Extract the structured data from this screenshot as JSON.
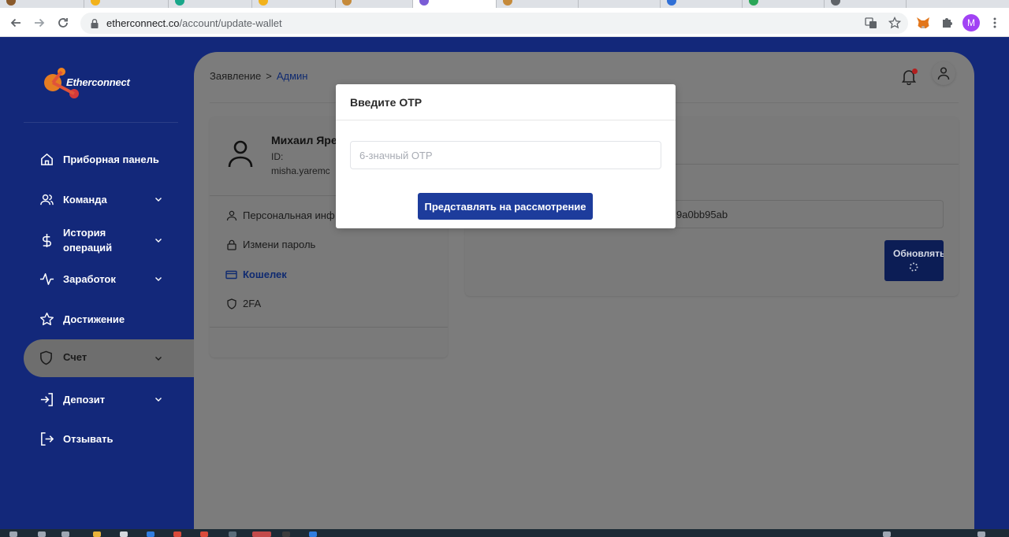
{
  "browser": {
    "url_domain": "etherconnect.co",
    "url_path": "/account/update-wallet",
    "profile_initial": "M"
  },
  "colors": {
    "sidebar_bg": "#13287a",
    "primary_button": "#1d3c9c",
    "accent_text": "#0f2a70",
    "notification_dot": "#b21f1f",
    "logo_orange": "#f0821e",
    "logo_red": "#d43a3a"
  },
  "logo": {
    "text": "Etherconnect"
  },
  "sidebar": {
    "items": [
      {
        "label": "Приборная панель",
        "icon": "home-icon",
        "has_chevron": false
      },
      {
        "label": "Команда",
        "icon": "users-icon",
        "has_chevron": true
      },
      {
        "label": "История операций",
        "icon": "dollar-icon",
        "has_chevron": true
      },
      {
        "label": "Заработок",
        "icon": "activity-icon",
        "has_chevron": true
      },
      {
        "label": "Достижение",
        "icon": "star-icon",
        "has_chevron": false
      },
      {
        "label": "Счет",
        "icon": "shield-icon",
        "has_chevron": true,
        "active": true
      },
      {
        "label": "Депозит",
        "icon": "login-icon",
        "has_chevron": true
      },
      {
        "label": "Отзывать",
        "icon": "logout-icon",
        "has_chevron": false
      }
    ]
  },
  "header": {
    "breadcrumb_parent": "Заявление",
    "breadcrumb_separator": ">",
    "breadcrumb_current": "Админ"
  },
  "profile_card": {
    "name": "Михаил Яре",
    "id_label": "ID:",
    "email": "misha.yaremc",
    "menu": [
      {
        "label": "Персональная инф",
        "icon": "user-icon"
      },
      {
        "label": "Измени пароль",
        "icon": "lock-icon"
      },
      {
        "label": "Кошелек",
        "icon": "credit-card-icon",
        "selected": true
      },
      {
        "label": "2FA",
        "icon": "shield-icon"
      }
    ]
  },
  "wallet_card": {
    "wallet_value_visible": "9a0bb95ab",
    "update_button": "Обновлять"
  },
  "modal": {
    "title": "Введите OTP",
    "otp_placeholder": "6-значный OTP",
    "otp_value": "",
    "submit_button": "Представлять на рассмотрение"
  }
}
